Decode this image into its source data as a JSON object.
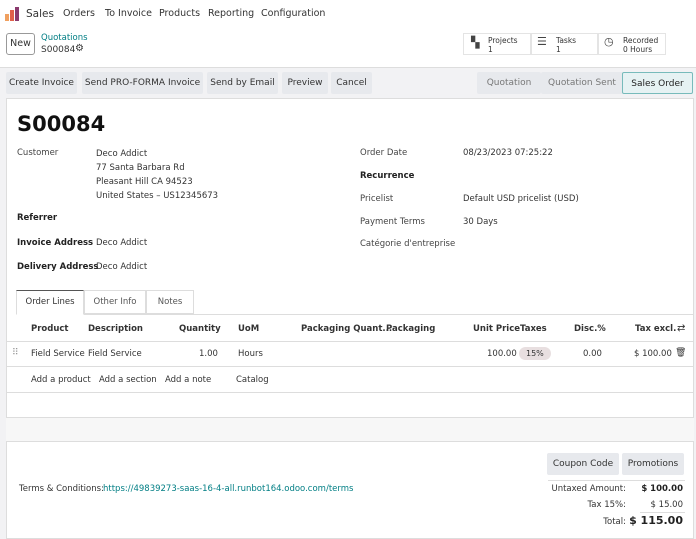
{
  "nav": {
    "app": "Sales",
    "items": [
      "Orders",
      "To Invoice",
      "Products",
      "Reporting",
      "Configuration"
    ]
  },
  "control": {
    "new": "New",
    "breadcrumb": "Quotations",
    "record": "S00084"
  },
  "stats": [
    {
      "label": "Projects",
      "value": "1"
    },
    {
      "label": "Tasks",
      "value": "1"
    },
    {
      "label": "Recorded",
      "value": "0 Hours"
    }
  ],
  "actions": [
    "Create Invoice",
    "Send PRO-FORMA Invoice",
    "Send by Email",
    "Preview",
    "Cancel"
  ],
  "stages": [
    "Quotation",
    "Quotation Sent",
    "Sales Order"
  ],
  "form": {
    "title": "S00084",
    "customer_label": "Customer",
    "customer": "Deco Addict",
    "addr1": "77 Santa Barbara Rd",
    "addr2": "Pleasant Hill CA 94523",
    "addr3": "United States – US12345673",
    "referrer_label": "Referrer",
    "invoice_label": "Invoice Address",
    "invoice": "Deco Addict",
    "delivery_label": "Delivery Address",
    "delivery": "Deco Addict",
    "order_date_label": "Order Date",
    "order_date": "08/23/2023 07:25:22",
    "recurrence_label": "Recurrence",
    "pricelist_label": "Pricelist",
    "pricelist": "Default USD pricelist (USD)",
    "terms_label": "Payment Terms",
    "terms": "30 Days",
    "categorie_label": "Catégorie d'entreprise"
  },
  "tabs": [
    "Order Lines",
    "Other Info",
    "Notes"
  ],
  "table": {
    "headers": [
      "Product",
      "Description",
      "Quantity",
      "UoM",
      "Packaging Quant...",
      "Packaging",
      "Unit Price",
      "Taxes",
      "Disc.%",
      "Tax excl."
    ],
    "row": {
      "product": "Field Service",
      "description": "Field Service",
      "quantity": "1.00",
      "uom": "Hours",
      "unit_price": "100.00",
      "taxes": "15%",
      "disc": "0.00",
      "subtotal": "$ 100.00"
    },
    "links": [
      "Add a product",
      "Add a section",
      "Add a note",
      "Catalog"
    ]
  },
  "footer": {
    "coupon": "Coupon Code",
    "promotions": "Promotions",
    "terms_label": "Terms & Conditions:",
    "terms_url": "https://49839273-saas-16-4-all.runbot164.odoo.com/terms",
    "untaxed_label": "Untaxed Amount:",
    "untaxed": "$ 100.00",
    "tax_label": "Tax 15%:",
    "tax": "$ 15.00",
    "total_label": "Total:",
    "total": "$ 115.00"
  }
}
